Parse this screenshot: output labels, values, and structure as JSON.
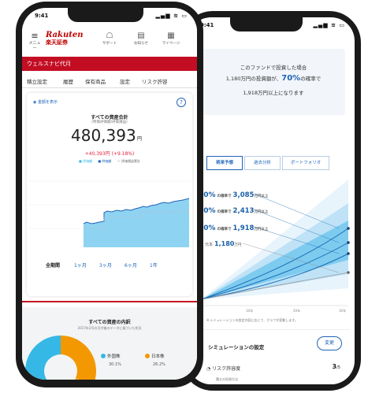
{
  "status": {
    "time": "9:41",
    "system_icons": "▂▄▆ ≋ ▭"
  },
  "left": {
    "header": {
      "menu_label": "メニュー",
      "logo_en": "Rakuten",
      "logo_jp": "楽天証券",
      "icons": [
        {
          "icon": "chat-icon",
          "glyph": "☖",
          "label": "サポート"
        },
        {
          "icon": "notice-icon",
          "glyph": "▤",
          "label": "お知らせ"
        },
        {
          "icon": "mypage-icon",
          "glyph": "▦",
          "label": "マイページ"
        }
      ]
    },
    "account_bar": "ウェルスナビ代月",
    "tabs": [
      "積立設定",
      "履歴",
      "保有商品",
      "設定",
      "リスク許容"
    ],
    "panel": {
      "hide_toggle": "◉ 金額を表示",
      "help": "?",
      "title": "すべての資産合計",
      "subtitle": "(時価評価額/評価損益)",
      "total": "480,393",
      "unit": "円",
      "profit": "+40,393円 (+9.18%)",
      "legend": [
        "■ 評価額",
        "■ 時価額",
        "— 評価損益累計"
      ],
      "periods": [
        "全期間",
        "1ヶ月",
        "3ヶ月",
        "6ヶ月",
        "1年"
      ]
    },
    "breakdown": {
      "title": "すべての資産の内訳",
      "subtitle": "2017年2月の日付後のデータに基づいた状況",
      "items": [
        {
          "label": "外国株",
          "pct": "30.1%",
          "color": "#35b8e6"
        },
        {
          "label": "日本株",
          "pct": "26.2%",
          "color": "#f39800"
        }
      ]
    }
  },
  "right": {
    "info": {
      "line1": "このファンドで投資した場合",
      "line2_pre": "1,180万円の投資額が、",
      "line2_pct": "70%",
      "line2_post": "の確率で",
      "line3": "1,918万円以上になります"
    },
    "tabs": [
      "将来予想",
      "過去分析",
      "ポートフォリオ"
    ],
    "sim": {
      "labels": [
        {
          "pct": "30%",
          "text": "の確率で",
          "amount": "3,085",
          "unit": "万円以上"
        },
        {
          "pct": "50%",
          "text": "の確率で",
          "amount": "2,413",
          "unit": "万円以上"
        },
        {
          "pct": "70%",
          "text": "の確率で",
          "amount": "1,918",
          "unit": "万円以上"
        },
        {
          "pct": "元本",
          "text": "",
          "amount": "1,180",
          "unit": "万円"
        }
      ],
      "x_ticks": [
        "10年",
        "20年",
        "30年"
      ],
      "note": "※ シミュレーションの設定内容に応じて、グラフが変動します。"
    },
    "settings": {
      "title": "シミュレーションの設定",
      "change": "変更",
      "risk_label": "リスク許容度",
      "risk_value": "3",
      "risk_unit": "/5",
      "risk_sub": "積立の投資方法"
    }
  }
}
